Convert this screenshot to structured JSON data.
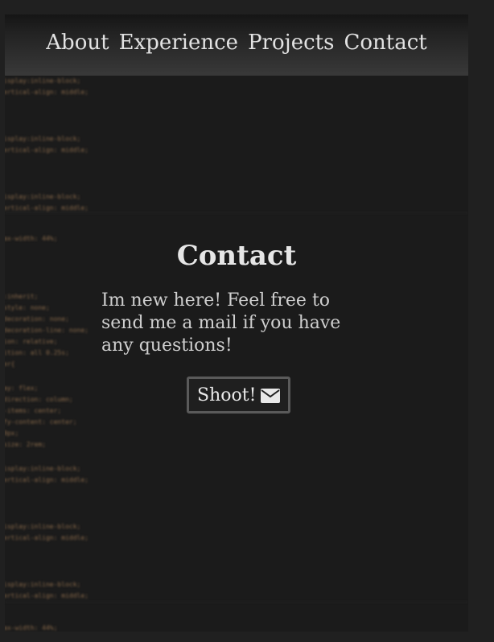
{
  "nav": {
    "items": [
      {
        "label": "About"
      },
      {
        "label": "Experience"
      },
      {
        "label": "Projects"
      },
      {
        "label": "Contact"
      }
    ]
  },
  "contact": {
    "title": "Contact",
    "text": "Im new here! Feel free to send me a mail if you have any questions!",
    "button_label": "Shoot!",
    "button_icon": "envelope-icon"
  },
  "background_code": {
    "lines": [
      "isplay:inline-block;",
      "ertical-align: middle;",
      "isplay:inline-block;",
      "ertical-align: middle;",
      "isplay:inline-block;",
      "ertical-align: middle;",
      "ax-width: 44%;",
      ":inherit;",
      "style: none;",
      "decoration: none;",
      "decoration-line: none;",
      "ion: relative;",
      "ition: all 0.25s;",
      "er{",
      "ay: flex;",
      "direction: column;",
      "-items: center;",
      "fy-content: center;",
      "0px;",
      "size: 2rem;",
      "isplay:inline-block;",
      "ertical-align: middle;",
      "isplay:inline-block;",
      "ertical-align: middle;",
      "isplay:inline-block;",
      "ertical-align: middle;",
      "ax-width: 44%;"
    ]
  }
}
